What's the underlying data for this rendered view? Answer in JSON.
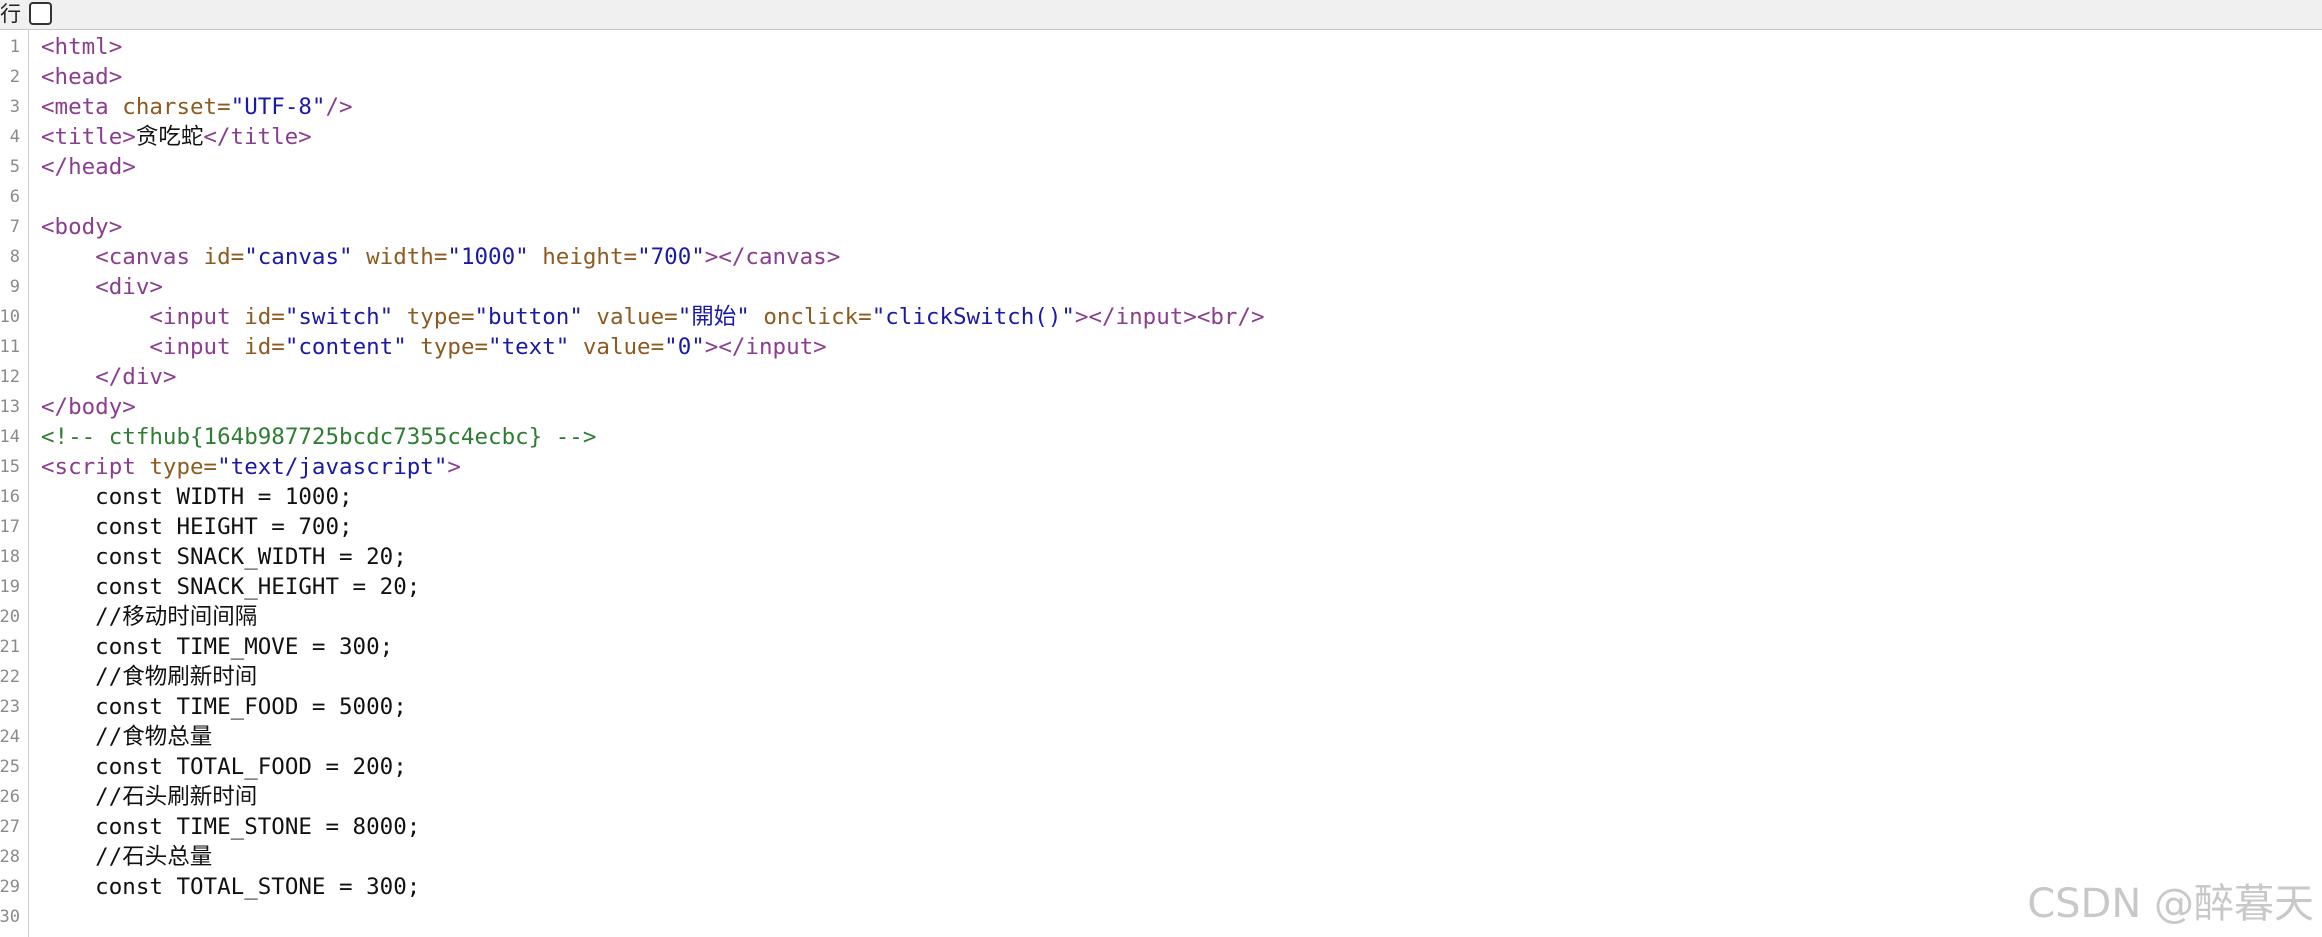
{
  "toolbar": {
    "wrap_label": "行",
    "wrap_checkbox_checked": false
  },
  "lines": [
    {
      "n": "1",
      "tokens": [
        {
          "t": "tag",
          "v": "<html>"
        }
      ]
    },
    {
      "n": "2",
      "tokens": [
        {
          "t": "tag",
          "v": "<head>"
        }
      ]
    },
    {
      "n": "3",
      "tokens": [
        {
          "t": "tag",
          "v": "<meta "
        },
        {
          "t": "attr",
          "v": "charset="
        },
        {
          "t": "val",
          "v": "\"UTF-8\""
        },
        {
          "t": "tag",
          "v": "/>"
        }
      ]
    },
    {
      "n": "4",
      "tokens": [
        {
          "t": "tag",
          "v": "<title>"
        },
        {
          "t": "plain",
          "v": "贪吃蛇"
        },
        {
          "t": "tag",
          "v": "</title>"
        }
      ]
    },
    {
      "n": "5",
      "tokens": [
        {
          "t": "tag",
          "v": "</head>"
        }
      ]
    },
    {
      "n": "6",
      "tokens": []
    },
    {
      "n": "7",
      "tokens": [
        {
          "t": "tag",
          "v": "<body>"
        }
      ]
    },
    {
      "n": "8",
      "tokens": [
        {
          "t": "plain",
          "v": "    "
        },
        {
          "t": "tag",
          "v": "<canvas "
        },
        {
          "t": "attr",
          "v": "id="
        },
        {
          "t": "val",
          "v": "\"canvas\""
        },
        {
          "t": "attr",
          "v": " width="
        },
        {
          "t": "val",
          "v": "\"1000\""
        },
        {
          "t": "attr",
          "v": " height="
        },
        {
          "t": "val",
          "v": "\"700\""
        },
        {
          "t": "tag",
          "v": "></canvas>"
        }
      ]
    },
    {
      "n": "9",
      "tokens": [
        {
          "t": "plain",
          "v": "    "
        },
        {
          "t": "tag",
          "v": "<div>"
        }
      ]
    },
    {
      "n": "10",
      "tokens": [
        {
          "t": "plain",
          "v": "        "
        },
        {
          "t": "tag",
          "v": "<input "
        },
        {
          "t": "attr",
          "v": "id="
        },
        {
          "t": "val",
          "v": "\"switch\""
        },
        {
          "t": "attr",
          "v": " type="
        },
        {
          "t": "val",
          "v": "\"button\""
        },
        {
          "t": "attr",
          "v": " value="
        },
        {
          "t": "val",
          "v": "\"開始\""
        },
        {
          "t": "attr",
          "v": " onclick="
        },
        {
          "t": "val",
          "v": "\"clickSwitch()\""
        },
        {
          "t": "tag",
          "v": "></input><br/>"
        }
      ]
    },
    {
      "n": "11",
      "tokens": [
        {
          "t": "plain",
          "v": "        "
        },
        {
          "t": "tag",
          "v": "<input "
        },
        {
          "t": "attr",
          "v": "id="
        },
        {
          "t": "val",
          "v": "\"content\""
        },
        {
          "t": "attr",
          "v": " type="
        },
        {
          "t": "val",
          "v": "\"text\""
        },
        {
          "t": "attr",
          "v": " value="
        },
        {
          "t": "val",
          "v": "\"0\""
        },
        {
          "t": "tag",
          "v": "></input>"
        }
      ]
    },
    {
      "n": "12",
      "tokens": [
        {
          "t": "plain",
          "v": "    "
        },
        {
          "t": "tag",
          "v": "</div>"
        }
      ]
    },
    {
      "n": "13",
      "tokens": [
        {
          "t": "tag",
          "v": "</body>"
        }
      ]
    },
    {
      "n": "14",
      "tokens": [
        {
          "t": "cmt",
          "v": "<!-- ctfhub{164b987725bcdc7355c4ecbc} -->"
        }
      ]
    },
    {
      "n": "15",
      "tokens": [
        {
          "t": "tag",
          "v": "<script "
        },
        {
          "t": "attr",
          "v": "type="
        },
        {
          "t": "val",
          "v": "\"text/javascript\""
        },
        {
          "t": "tag",
          "v": ">"
        }
      ]
    },
    {
      "n": "16",
      "tokens": [
        {
          "t": "plain",
          "v": "    const WIDTH = 1000;"
        }
      ]
    },
    {
      "n": "17",
      "tokens": [
        {
          "t": "plain",
          "v": "    const HEIGHT = 700;"
        }
      ]
    },
    {
      "n": "18",
      "tokens": [
        {
          "t": "plain",
          "v": "    const SNACK_WIDTH = 20;"
        }
      ]
    },
    {
      "n": "19",
      "tokens": [
        {
          "t": "plain",
          "v": "    const SNACK_HEIGHT = 20;"
        }
      ]
    },
    {
      "n": "20",
      "tokens": [
        {
          "t": "plain",
          "v": "    //移动时间间隔"
        }
      ]
    },
    {
      "n": "21",
      "tokens": [
        {
          "t": "plain",
          "v": "    const TIME_MOVE = 300;"
        }
      ]
    },
    {
      "n": "22",
      "tokens": [
        {
          "t": "plain",
          "v": "    //食物刷新时间"
        }
      ]
    },
    {
      "n": "23",
      "tokens": [
        {
          "t": "plain",
          "v": "    const TIME_FOOD = 5000;"
        }
      ]
    },
    {
      "n": "24",
      "tokens": [
        {
          "t": "plain",
          "v": "    //食物总量"
        }
      ]
    },
    {
      "n": "25",
      "tokens": [
        {
          "t": "plain",
          "v": "    const TOTAL_FOOD = 200;"
        }
      ]
    },
    {
      "n": "26",
      "tokens": [
        {
          "t": "plain",
          "v": "    //石头刷新时间"
        }
      ]
    },
    {
      "n": "27",
      "tokens": [
        {
          "t": "plain",
          "v": "    const TIME_STONE = 8000;"
        }
      ]
    },
    {
      "n": "28",
      "tokens": [
        {
          "t": "plain",
          "v": "    //石头总量"
        }
      ]
    },
    {
      "n": "29",
      "tokens": [
        {
          "t": "plain",
          "v": "    const TOTAL_STONE = 300;"
        }
      ]
    },
    {
      "n": "30",
      "tokens": []
    }
  ],
  "watermark": "CSDN @醉暮天"
}
